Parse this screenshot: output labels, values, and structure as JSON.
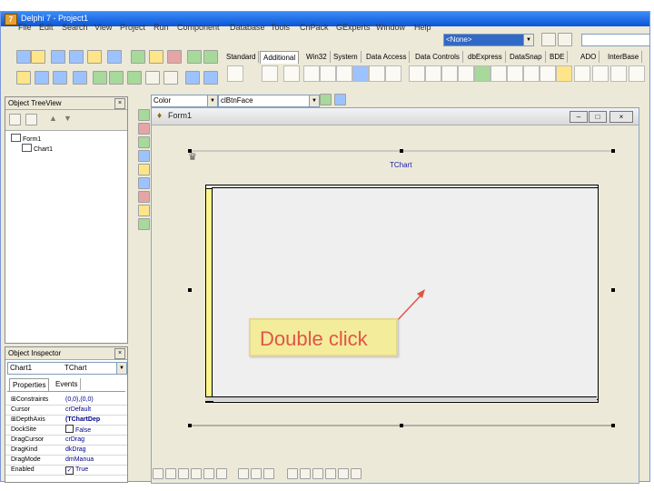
{
  "window": {
    "title": "Delphi 7 - Project1"
  },
  "menu": [
    "File",
    "Edit",
    "Search",
    "View",
    "Project",
    "Run",
    "Component",
    "Database",
    "Tools",
    "CnPack",
    "GExperts",
    "Window",
    "Help"
  ],
  "toolbar": {
    "desktop_combo_value": "<None>"
  },
  "palette_tabs": [
    "Standard",
    "Additional",
    "Win32",
    "System",
    "Data Access",
    "Data Controls",
    "dbExpress",
    "DataSnap",
    "BDE",
    "ADO",
    "InterBase"
  ],
  "palette_active_tab": "Additional",
  "object_treeview": {
    "title": "Object TreeView",
    "items": [
      {
        "label": "Form1"
      },
      {
        "label": "Chart1"
      }
    ]
  },
  "object_inspector": {
    "title": "Object Inspector",
    "selected_object": "Chart1",
    "selected_type": "TChart",
    "tabs": [
      "Properties",
      "Events"
    ],
    "rows": [
      {
        "name": "Constraints",
        "value": "(0,0),(0,0)",
        "prefix": "⊞"
      },
      {
        "name": "Cursor",
        "value": "crDefault",
        "prefix": ""
      },
      {
        "name": "DepthAxis",
        "value": "(TChartDep",
        "prefix": "⊞"
      },
      {
        "name": "DockSite",
        "value": "False",
        "prefix": "",
        "checkbox": true
      },
      {
        "name": "DragCursor",
        "value": "crDrag",
        "prefix": ""
      },
      {
        "name": "DragKind",
        "value": "dkDrag",
        "prefix": ""
      },
      {
        "name": "DragMode",
        "value": "dmManua",
        "prefix": ""
      },
      {
        "name": "Enabled",
        "value": "True",
        "prefix": "",
        "checkbox": true,
        "checked": true
      }
    ]
  },
  "editor_toolbar": {
    "property_combo": "Color",
    "value_combo": "clBtnFace"
  },
  "form_designer": {
    "title": "Form1",
    "chart_title": "TChart"
  },
  "annotation": {
    "text": "Double click",
    "color": "#e0554a"
  },
  "colors": {
    "title_bar": "#0a55d8",
    "chart_side": "#fdf58a",
    "callout_bg": "#f3ec9a"
  }
}
